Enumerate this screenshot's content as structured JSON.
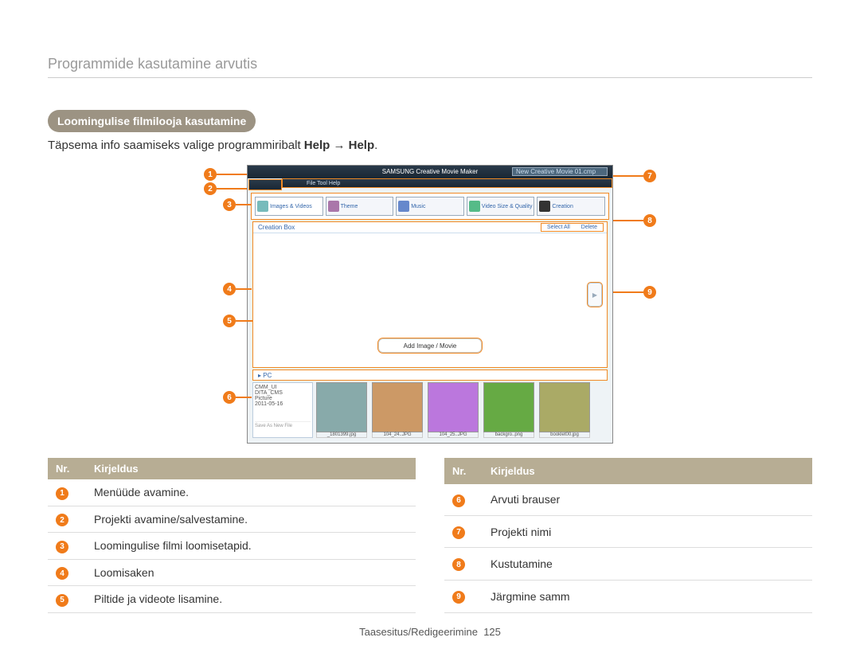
{
  "breadcrumb": "Programmide kasutamine arvutis",
  "section_title": "Loomingulise filmilooja kasutamine",
  "instruction_prefix": "Täpsema info saamiseks valige programmiribalt ",
  "instruction_bold": "Help → Help",
  "instruction_suffix": ".",
  "app": {
    "titlebar": "SAMSUNG Creative Movie Maker",
    "project_name": "New Creative Movie 01.cmp",
    "menu_items": "File   Tool   Help",
    "tabs": {
      "images_videos": "Images & Videos",
      "theme": "Theme",
      "music": "Music",
      "video_size": "Video Size & Quality",
      "creation": "Creation"
    },
    "creation_box_label": "Creation Box",
    "select_all": "Select All",
    "delete": "Delete",
    "add_pill": "Add Image / Movie",
    "next_glyph": "▶",
    "pc_label": "PC",
    "tree": [
      "CMM_UI",
      "DITA_CMS",
      "Picture",
      "2011-05-16"
    ],
    "save_as": "Save As New File",
    "thumbs": [
      "_1801399.jpg",
      "104_24..JPG",
      "104_25..JPG",
      "backgro..png",
      "booklet00.jpg"
    ]
  },
  "callouts": {
    "n1": "1",
    "n2": "2",
    "n3": "3",
    "n4": "4",
    "n5": "5",
    "n6": "6",
    "n7": "7",
    "n8": "8",
    "n9": "9"
  },
  "table_headers": {
    "nr": "Nr.",
    "desc": "Kirjeldus"
  },
  "left_rows": [
    {
      "n": "1",
      "d": "Menüüde avamine."
    },
    {
      "n": "2",
      "d": "Projekti avamine/salvestamine."
    },
    {
      "n": "3",
      "d": "Loomingulise filmi loomisetapid."
    },
    {
      "n": "4",
      "d": "Loomisaken"
    },
    {
      "n": "5",
      "d": "Piltide ja videote lisamine."
    }
  ],
  "right_rows": [
    {
      "n": "6",
      "d": "Arvuti brauser"
    },
    {
      "n": "7",
      "d": "Projekti nimi"
    },
    {
      "n": "8",
      "d": "Kustutamine"
    },
    {
      "n": "9",
      "d": "Järgmine samm"
    }
  ],
  "footer_label": "Taasesitus/Redigeerimine",
  "footer_page": "125"
}
